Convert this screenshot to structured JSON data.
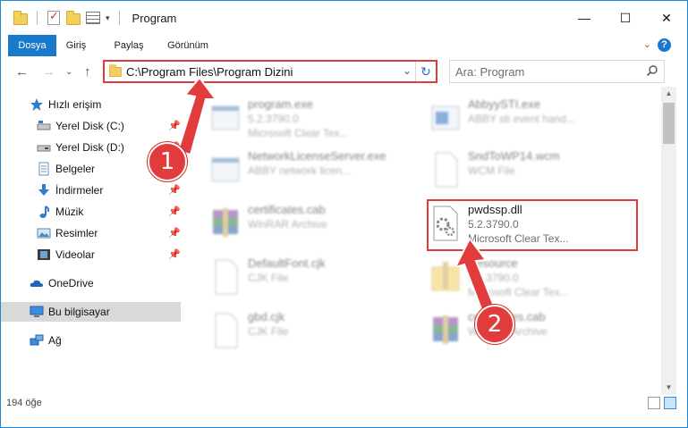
{
  "window": {
    "title": "Program",
    "controls": {
      "minimize": "—",
      "maximize": "☐",
      "close": "✕"
    }
  },
  "ribbon": {
    "tabs": [
      {
        "label": "Dosya",
        "active": true
      },
      {
        "label": "Giriş"
      },
      {
        "label": "Paylaş"
      },
      {
        "label": "Görünüm"
      }
    ],
    "help": "?"
  },
  "address": {
    "path": "C:\\Program Files\\Program Dizini",
    "search_placeholder": "Ara: Program"
  },
  "sidebar": {
    "items": [
      {
        "label": "Hızlı erişim",
        "icon": "star-icon"
      },
      {
        "label": "Yerel Disk (C:)",
        "icon": "drive-icon",
        "pinned": true
      },
      {
        "label": "Yerel Disk (D:)",
        "icon": "drive-icon",
        "pinned": true
      },
      {
        "label": "Belgeler",
        "icon": "documents-icon",
        "pinned": true
      },
      {
        "label": "İndirmeler",
        "icon": "download-icon",
        "pinned": true
      },
      {
        "label": "Müzik",
        "icon": "music-icon",
        "pinned": true
      },
      {
        "label": "Resimler",
        "icon": "pictures-icon",
        "pinned": true
      },
      {
        "label": "Videolar",
        "icon": "videos-icon",
        "pinned": true
      },
      {
        "label": "OneDrive",
        "icon": "cloud-icon"
      },
      {
        "label": "Bu bilgisayar",
        "icon": "computer-icon",
        "selected": true
      },
      {
        "label": "Ağ",
        "icon": "network-icon"
      }
    ]
  },
  "files": [
    {
      "name": "program.exe",
      "line1": "5.2.3790.0",
      "line2": "Microsoft Clear Tex...",
      "icon": "exe-icon"
    },
    {
      "name": "AbbyySTI.exe",
      "line1": "ABBY sti event hand...",
      "line2": "",
      "icon": "exe-icon"
    },
    {
      "name": "NetworkLicenseServer.exe",
      "line1": "ABBY network licen...",
      "line2": "",
      "icon": "exe-icon"
    },
    {
      "name": "SndToWP14.wcm",
      "line1": "WCM File",
      "line2": "",
      "icon": "file-icon"
    },
    {
      "name": "certificates.cab",
      "line1": "WinRAR Archive",
      "line2": "",
      "icon": "archive-icon"
    },
    {
      "name": "pwdssp.dll",
      "line1": "5.2.3790.0",
      "line2": "Microsoft Clear Tex...",
      "icon": "dll-icon"
    },
    {
      "name": "DefaultFont.cjk",
      "line1": "CJK File",
      "line2": "",
      "icon": "file-icon"
    },
    {
      "name": "Resource",
      "line1": "5.2.3790.0",
      "line2": "Microsoft Clear Tex...",
      "icon": "folder-icon"
    },
    {
      "name": "gbd.cjk",
      "line1": "CJK File",
      "line2": "",
      "icon": "file-icon"
    },
    {
      "name": "certificates.cab",
      "line1": "WinRAR Archive",
      "line2": "",
      "icon": "archive-icon"
    }
  ],
  "status": {
    "count": "194 öğe"
  },
  "annotations": {
    "badge1": "1",
    "badge2": "2"
  },
  "colors": {
    "accent": "#1979ca",
    "highlight": "#e23b3b"
  }
}
